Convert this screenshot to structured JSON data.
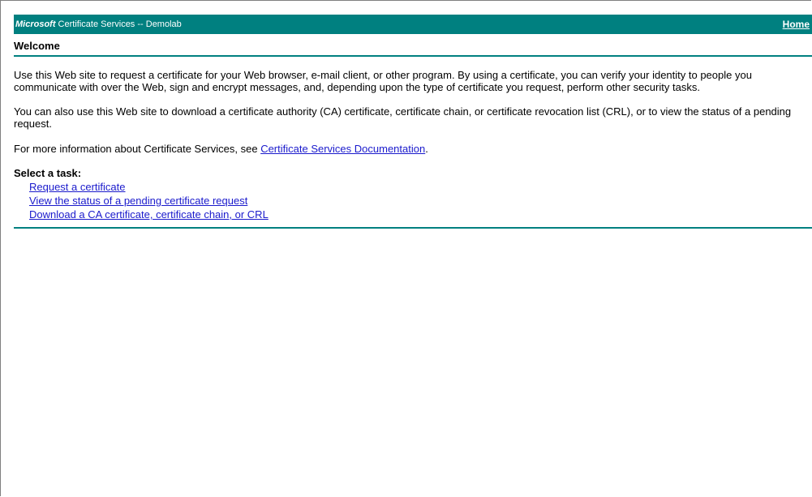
{
  "banner": {
    "brand": "Microsoft",
    "title": " Certificate Services  --  Demolab",
    "home_label": "Home"
  },
  "page": {
    "title": "Welcome",
    "paragraph1": "Use this Web site to request a certificate for your Web browser, e-mail client, or other program. By using a certificate, you can verify your identity to people you communicate with over the Web, sign and encrypt messages, and, depending upon the type of certificate you request, perform other security tasks.",
    "paragraph2": "You can also use this Web site to download a certificate authority (CA) certificate, certificate chain, or certificate revocation list (CRL), or to view the status of a pending request.",
    "paragraph3_prefix": "For more information about Certificate Services, see ",
    "paragraph3_link": "Certificate Services Documentation",
    "paragraph3_suffix": "."
  },
  "tasks": {
    "heading": "Select a task:",
    "items": [
      {
        "label": "Request a certificate"
      },
      {
        "label": "View the status of a pending certificate request"
      },
      {
        "label": "Download a CA certificate, certificate chain, or CRL"
      }
    ]
  },
  "colors": {
    "accent": "#008080",
    "link": "#1a1acc"
  }
}
